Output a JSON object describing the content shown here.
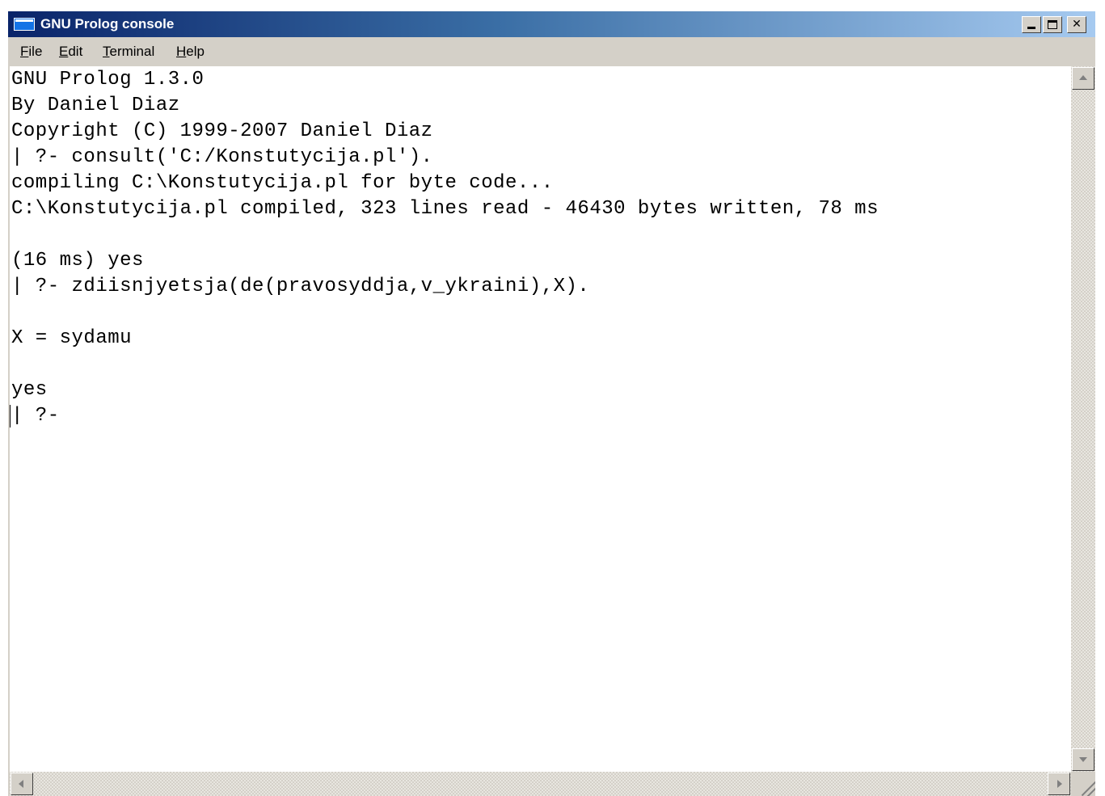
{
  "window": {
    "title": "GNU Prolog console"
  },
  "menu": {
    "items": [
      {
        "accel": "F",
        "rest": "ile"
      },
      {
        "accel": "E",
        "rest": "dit"
      },
      {
        "accel": "T",
        "rest": "erminal"
      },
      {
        "accel": "H",
        "rest": "elp"
      }
    ]
  },
  "console": {
    "lines": [
      "GNU Prolog 1.3.0",
      "By Daniel Diaz",
      "Copyright (C) 1999-2007 Daniel Diaz",
      "| ?- consult('C:/Konstutycija.pl').",
      "compiling C:\\Konstutycija.pl for byte code...",
      "C:\\Konstutycija.pl compiled, 323 lines read - 46430 bytes written, 78 ms",
      "",
      "(16 ms) yes",
      "| ?- zdiisnjyetsja(de(pravosyddja,v_ykraini),X).",
      "",
      "X = sydamu",
      "",
      "yes",
      "| ?-"
    ]
  }
}
